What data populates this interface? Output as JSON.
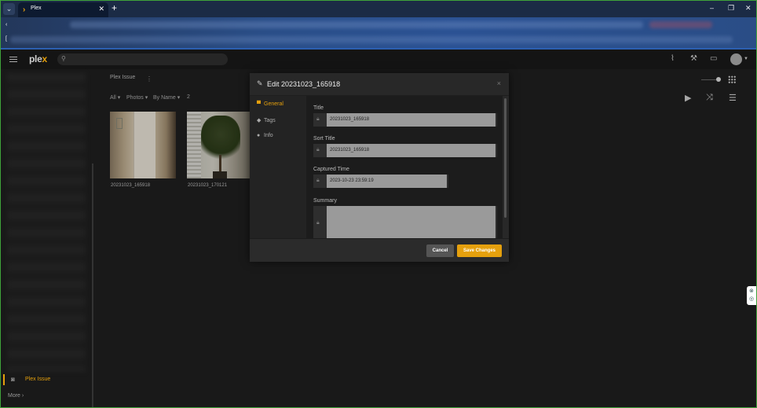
{
  "browser": {
    "tab_menu_icon": "chevron-down-icon",
    "tab_title": "Plex",
    "tab_close": "✕",
    "new_tab": "+",
    "window_controls": [
      "–",
      "❐",
      "✕"
    ],
    "back_glyph": "‹",
    "bookmark_glyph": "["
  },
  "plex": {
    "logo_text_1": "ple",
    "logo_text_2": "x",
    "header_icons": [
      "activity-icon",
      "settings-icon",
      "cast-icon"
    ]
  },
  "library": {
    "title": "Plex Issue",
    "more_glyph": "⋮",
    "filters": {
      "all": "All ▾",
      "type": "Photos ▾",
      "sort": "By Name ▾",
      "count": "2"
    },
    "items": [
      {
        "caption": "20231023_165918"
      },
      {
        "caption": "20231023_170121"
      }
    ]
  },
  "sidebar": {
    "active_item": "Plex Issue",
    "more": "More ›"
  },
  "modal": {
    "title": "Edit 20231023_165918",
    "close": "×",
    "nav": [
      {
        "label": "General",
        "icon": "general-icon"
      },
      {
        "label": "Tags",
        "icon": "tag-icon"
      },
      {
        "label": "Info",
        "icon": "info-icon"
      }
    ],
    "fields": {
      "title_label": "Title",
      "title_value": "20231023_165918",
      "sort_label": "Sort Title",
      "sort_value": "20231023_165918",
      "captured_label": "Captured Time",
      "captured_value": "2023-10-23 23:59:19",
      "summary_label": "Summary",
      "summary_value": ""
    },
    "cancel": "Cancel",
    "save": "Save Changes"
  },
  "colors": {
    "accent": "#e5a00d",
    "border": "#3fa23a"
  }
}
